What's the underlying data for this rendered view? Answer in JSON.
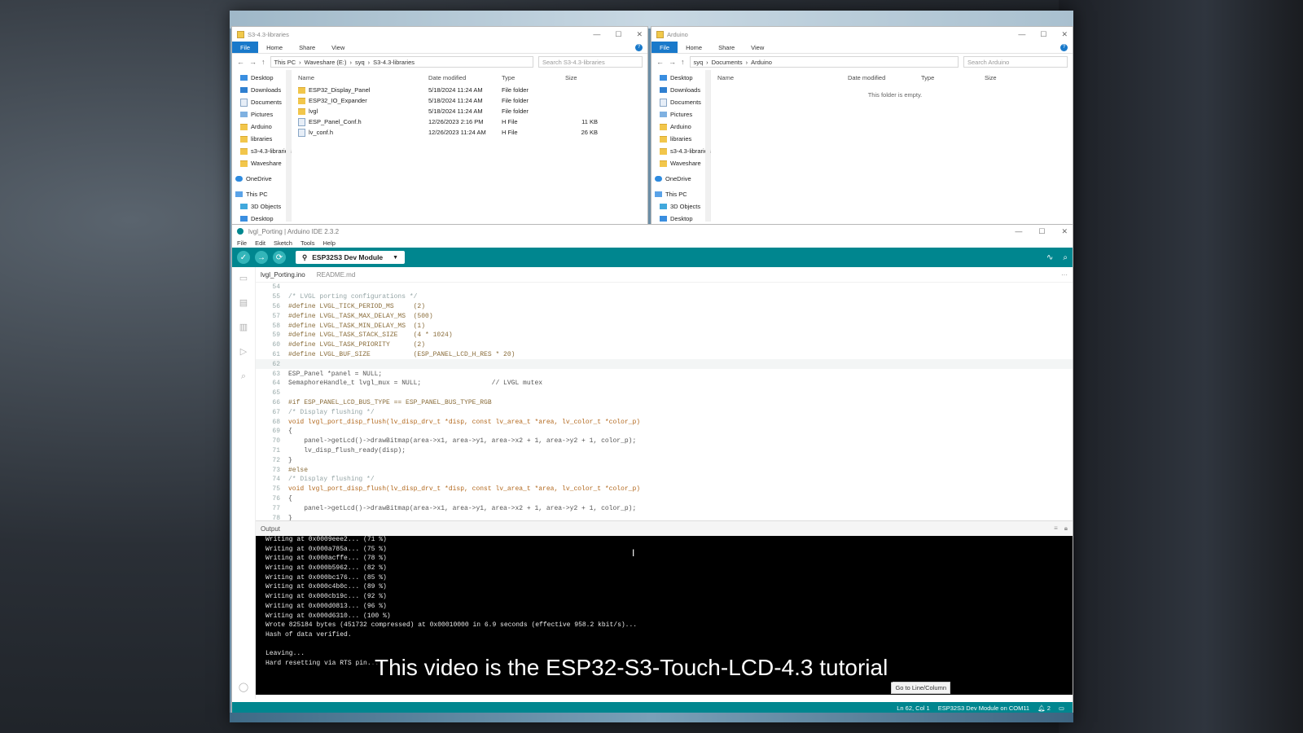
{
  "explorer_left": {
    "title": "S3-4.3-libraries",
    "ribbon": [
      "File",
      "Home",
      "Share",
      "View"
    ],
    "path": [
      "This PC",
      "Waveshare (E:)",
      "syq",
      "S3-4.3-libraries"
    ],
    "search_placeholder": "Search S3-4.3-libraries",
    "nav": [
      "Desktop",
      "Downloads",
      "Documents",
      "Pictures",
      "Arduino",
      "libraries",
      "s3-4.3-libraries",
      "Waveshare",
      "OneDrive",
      "This PC",
      "3D Objects",
      "Desktop"
    ],
    "columns": [
      "Name",
      "Date modified",
      "Type",
      "Size"
    ],
    "files": [
      {
        "name": "ESP32_Display_Panel",
        "date": "5/18/2024 11:24 AM",
        "type": "File folder",
        "size": ""
      },
      {
        "name": "ESP32_IO_Expander",
        "date": "5/18/2024 11:24 AM",
        "type": "File folder",
        "size": ""
      },
      {
        "name": "lvgl",
        "date": "5/18/2024 11:24 AM",
        "type": "File folder",
        "size": ""
      },
      {
        "name": "ESP_Panel_Conf.h",
        "date": "12/26/2023 2:16 PM",
        "type": "H File",
        "size": "11 KB"
      },
      {
        "name": "lv_conf.h",
        "date": "12/26/2023 11:24 AM",
        "type": "H File",
        "size": "26 KB"
      }
    ]
  },
  "explorer_right": {
    "title": "Arduino",
    "ribbon": [
      "File",
      "Home",
      "Share",
      "View"
    ],
    "path": [
      "syq",
      "Documents",
      "Arduino"
    ],
    "search_placeholder": "Search Arduino",
    "nav": [
      "Desktop",
      "Downloads",
      "Documents",
      "Pictures",
      "Arduino",
      "libraries",
      "s3-4.3-libraries",
      "Waveshare",
      "OneDrive",
      "This PC",
      "3D Objects",
      "Desktop"
    ],
    "columns": [
      "Name",
      "Date modified",
      "Type",
      "Size"
    ],
    "empty_text": "This folder is empty."
  },
  "ide": {
    "title": "lvgl_Porting | Arduino IDE 2.3.2",
    "menu": [
      "File",
      "Edit",
      "Sketch",
      "Tools",
      "Help"
    ],
    "board": "ESP32S3 Dev Module",
    "tabs": [
      "lvgl_Porting.ino",
      "README.md"
    ],
    "code_lines": [
      {
        "n": "54",
        "t": ""
      },
      {
        "n": "55",
        "t": "/* LVGL porting configurations */"
      },
      {
        "n": "56",
        "t": "#define LVGL_TICK_PERIOD_MS     (2)"
      },
      {
        "n": "57",
        "t": "#define LVGL_TASK_MAX_DELAY_MS  (500)"
      },
      {
        "n": "58",
        "t": "#define LVGL_TASK_MIN_DELAY_MS  (1)"
      },
      {
        "n": "59",
        "t": "#define LVGL_TASK_STACK_SIZE    (4 * 1024)"
      },
      {
        "n": "60",
        "t": "#define LVGL_TASK_PRIORITY      (2)"
      },
      {
        "n": "61",
        "t": "#define LVGL_BUF_SIZE           (ESP_PANEL_LCD_H_RES * 20)"
      },
      {
        "n": "62",
        "t": ""
      },
      {
        "n": "63",
        "t": "ESP_Panel *panel = NULL;"
      },
      {
        "n": "64",
        "t": "SemaphoreHandle_t lvgl_mux = NULL;                  // LVGL mutex"
      },
      {
        "n": "65",
        "t": ""
      },
      {
        "n": "66",
        "t": "#if ESP_PANEL_LCD_BUS_TYPE == ESP_PANEL_BUS_TYPE_RGB"
      },
      {
        "n": "67",
        "t": "/* Display flushing */"
      },
      {
        "n": "68",
        "t": "void lvgl_port_disp_flush(lv_disp_drv_t *disp, const lv_area_t *area, lv_color_t *color_p)"
      },
      {
        "n": "69",
        "t": "{"
      },
      {
        "n": "70",
        "t": "    panel->getLcd()->drawBitmap(area->x1, area->y1, area->x2 + 1, area->y2 + 1, color_p);"
      },
      {
        "n": "71",
        "t": "    lv_disp_flush_ready(disp);"
      },
      {
        "n": "72",
        "t": "}"
      },
      {
        "n": "73",
        "t": "#else"
      },
      {
        "n": "74",
        "t": "/* Display flushing */"
      },
      {
        "n": "75",
        "t": "void lvgl_port_disp_flush(lv_disp_drv_t *disp, const lv_area_t *area, lv_color_t *color_p)"
      },
      {
        "n": "76",
        "t": "{"
      },
      {
        "n": "77",
        "t": "    panel->getLcd()->drawBitmap(area->x1, area->y1, area->x2 + 1, area->y2 + 1, color_p);"
      },
      {
        "n": "78",
        "t": "}"
      }
    ],
    "output_label": "Output",
    "output_lines": [
      "Writing at 0x0009eee2... (71 %)",
      "Writing at 0x000a785a... (75 %)",
      "Writing at 0x000acffe... (78 %)",
      "Writing at 0x000b5962... (82 %)",
      "Writing at 0x000bc176... (85 %)",
      "Writing at 0x000c4b0c... (89 %)",
      "Writing at 0x000cb19c... (92 %)",
      "Writing at 0x000d0813... (96 %)",
      "Writing at 0x000d6310... (100 %)",
      "Wrote 825184 bytes (451732 compressed) at 0x00010000 in 6.9 seconds (effective 958.2 kbit/s)...",
      "Hash of data verified.",
      "",
      "Leaving...",
      "Hard resetting via RTS pin..."
    ],
    "tooltip": "Go to Line/Column",
    "status": {
      "position": "Ln 62, Col 1",
      "board_port": "ESP32S3 Dev Module on COM11",
      "notifications": "2"
    }
  },
  "caption": "This video is the ESP32-S3-Touch-LCD-4.3 tutorial",
  "colors": {
    "teal": "#00868f",
    "folder": "#f2c64b",
    "file_tab": "#1979ca"
  }
}
